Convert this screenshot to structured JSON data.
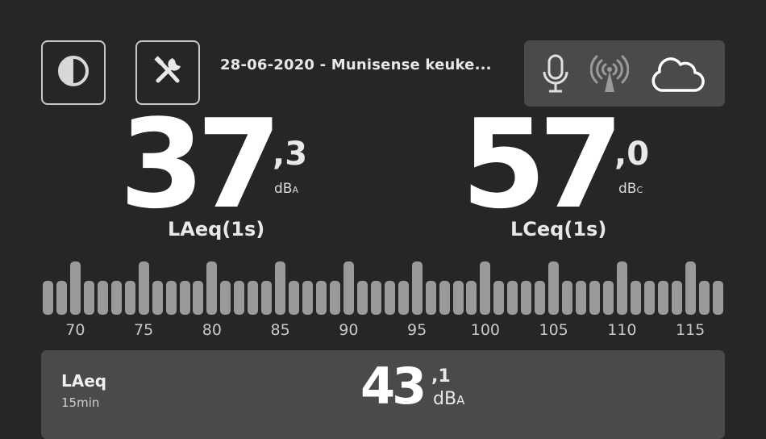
{
  "header": {
    "session_title": "28-06-2020 - Munisense keuke..."
  },
  "icons": {
    "contrast": "contrast-icon",
    "tools": "tools-icon",
    "microphone": "microphone-icon",
    "antenna": "antenna-icon",
    "cloud": "cloud-icon"
  },
  "readings": [
    {
      "integer": "37",
      "decimal": ",3",
      "unit_main": "dB",
      "unit_sub": "A",
      "label": "LAeq(1s)"
    },
    {
      "integer": "57",
      "decimal": ",0",
      "unit_main": "dB",
      "unit_sub": "C",
      "label": "LCeq(1s)"
    }
  ],
  "meter": {
    "tick_labels": [
      "70",
      "75",
      "80",
      "85",
      "90",
      "95",
      "100",
      "105",
      "110",
      "115"
    ],
    "bar_color": "#9a9a9a"
  },
  "summary": {
    "label": "LAeq",
    "period": "15min",
    "integer": "43",
    "decimal": ",1",
    "unit_main": "dB",
    "unit_sub": "A"
  },
  "colors": {
    "background": "#262626",
    "panel": "#4a4a4a",
    "text": "#ffffff"
  }
}
